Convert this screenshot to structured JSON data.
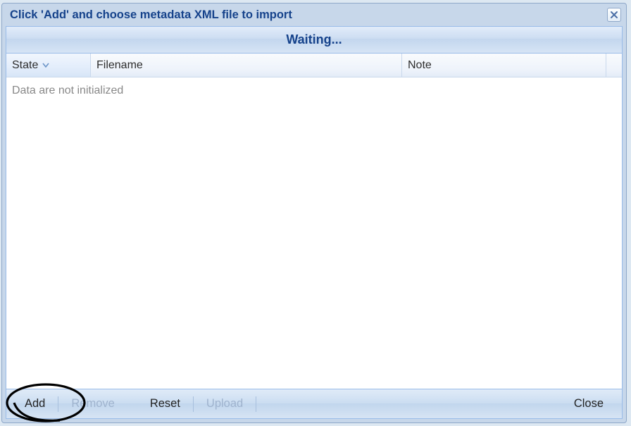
{
  "dialog": {
    "title": "Click 'Add' and choose metadata XML file to import",
    "status": "Waiting..."
  },
  "table": {
    "columns": {
      "state": "State",
      "filename": "Filename",
      "note": "Note"
    },
    "empty_message": "Data are not initialized"
  },
  "toolbar": {
    "add": "Add",
    "remove": "Remove",
    "reset": "Reset",
    "upload": "Upload",
    "close": "Close"
  }
}
